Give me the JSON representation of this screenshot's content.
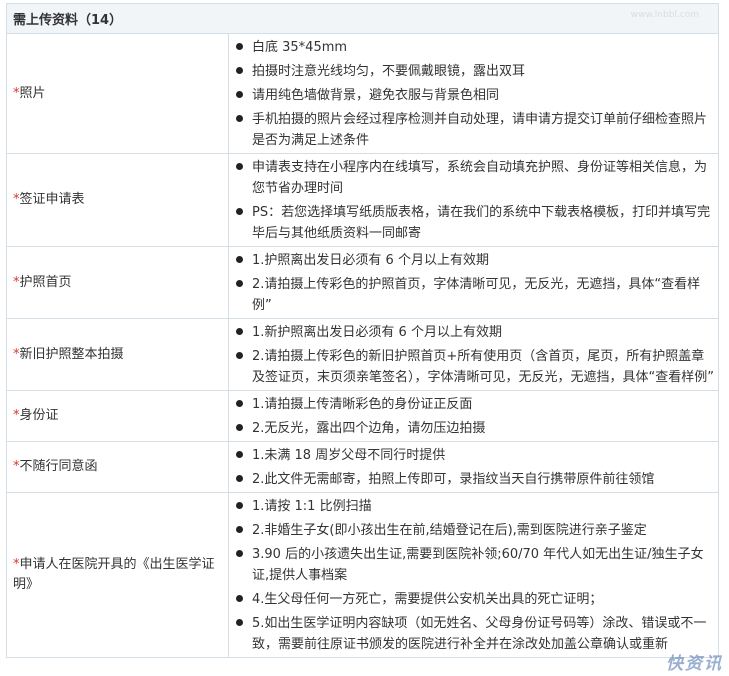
{
  "title": "需上传资料（14）",
  "watermark": {
    "logo_text": "快资讯",
    "url": "www.lnbbl.com"
  },
  "rows": [
    {
      "label": "照片",
      "items": [
        "白底  35*45mm",
        "拍摄时注意光线均匀，不要佩戴眼镜，露出双耳",
        "请用纯色墙做背景，避免衣服与背景色相同",
        "手机拍摄的照片会经过程序检测并自动处理，请申请方提交订单前仔细检查照片是否为满足上述条件"
      ]
    },
    {
      "label": "签证申请表",
      "items": [
        "申请表支持在小程序内在线填写，系统会自动填充护照、身份证等相关信息，为您节省办理时间",
        "PS：若您选择填写纸质版表格，请在我们的系统中下载表格模板，打印并填写完毕后与其他纸质资料一同邮寄"
      ]
    },
    {
      "label": "护照首页",
      "items": [
        "1.护照离出发日必须有 6 个月以上有效期",
        "2.请拍摄上传彩色的护照首页，字体清晰可见，无反光，无遮挡，具体“查看样例”"
      ]
    },
    {
      "label": "新旧护照整本拍摄",
      "items": [
        "1.新护照离出发日必须有 6 个月以上有效期",
        "2.请拍摄上传彩色的新旧护照首页+所有使用页（含首页，尾页，所有护照盖章及签证页，末页须亲笔签名），字体清晰可见，无反光，无遮挡，具体“查看样例”"
      ]
    },
    {
      "label": "身份证",
      "items": [
        "1.请拍摄上传清晰彩色的身份证正反面",
        "2.无反光，露出四个边角，请勿压边拍摄"
      ]
    },
    {
      "label": "不随行同意函",
      "items": [
        "1.未满 18 周岁父母不同行时提供",
        "2.此文件无需邮寄，拍照上传即可，录指纹当天自行携带原件前往领馆"
      ]
    },
    {
      "label": "申请人在医院开具的《出生医学证明》",
      "items": [
        "1.请按 1:1 比例扫描",
        "2.非婚生子女(即小孩出生在前,结婚登记在后),需到医院进行亲子鉴定",
        "3.90 后的小孩遗失出生证,需要到医院补领;60/70 年代人如无出生证/独生子女证,提供人事档案",
        "4.生父母任何一方死亡，需要提供公安机关出具的死亡证明；",
        "5.如出生医学证明内容缺项（如无姓名、父母身份证号码等）涂改、错误或不一致，需要前往原证书颁发的医院进行补全并在涂改处加盖公章确认或重新"
      ]
    }
  ]
}
